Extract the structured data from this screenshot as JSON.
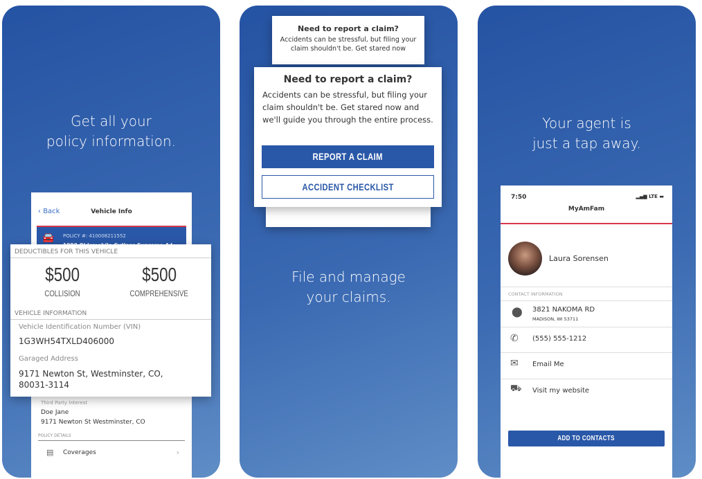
{
  "panel1": {
    "headline_line1": "Get all your",
    "headline_line2": "policy information.",
    "back_label": "Back",
    "screen_title": "Vehicle Info",
    "policy_number": "POLICY #: 410008211552",
    "vehicle": "1990 Oldsmobile Cutlass Supreme 4d",
    "deductibles_header": "DEDUCTIBLES FOR THIS VEHICLE",
    "collision_amount": "$500",
    "collision_label": "COLLISION",
    "comprehensive_amount": "$500",
    "comprehensive_label": "COMPREHENSIVE",
    "vehicle_info_header": "VEHICLE INFORMATION",
    "vin_label": "Vehicle Identification Number (VIN)",
    "vin": "1G3WH54TXLD406000",
    "garaged_label": "Garaged Address",
    "garaged_line1": "9171 Newton St, Westminster, CO,",
    "garaged_line2": "80031-3114",
    "third_party_label": "Third Party Interest",
    "third_party_name": "Doe Jane",
    "third_party_address": "9171 Newton St Westminster, CO",
    "policy_details_header": "POLICY DETAILS",
    "coverages": "Coverages"
  },
  "panel2": {
    "back_title": "Need to report a claim?",
    "back_body": "Accidents can be stressful, but filing your claim shouldn't be. Get stared now",
    "title": "Need to report a claim?",
    "body": "Accidents can be stressful, but filing your claim shouldn't be. Get stared now and we'll guide you through the entire process.",
    "report_button": "REPORT A CLAIM",
    "checklist_button": "ACCIDENT CHECKLIST",
    "headline_line1": "File and manage",
    "headline_line2": "your claims.",
    "accent": "#2a58a8"
  },
  "panel3": {
    "headline_line1": "Your agent is",
    "headline_line2": "just a tap away.",
    "time": "7:50",
    "network": "LTE",
    "app_title": "MyAmFam",
    "agent_name": "Laura Sorensen",
    "contact_header": "CONTACT INFORMATION",
    "address_line1": "3821 NAKOMA RD",
    "address_line2": "MADISON, WI 53711",
    "phone": "(555) 555-1212",
    "email": "Email Me",
    "website": "Visit my website",
    "add_button": "ADD TO CONTACTS",
    "accent_red": "#d8364a"
  }
}
